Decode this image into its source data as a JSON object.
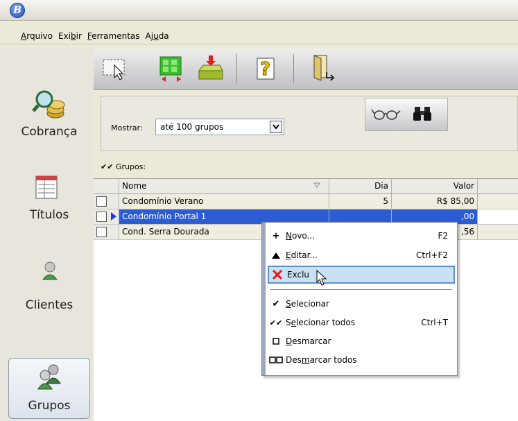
{
  "window": {
    "logo_letter": "B"
  },
  "menu": [
    "Arquivo",
    "Exibir",
    "Ferramentas",
    "Ajuda"
  ],
  "sidebar": {
    "items": [
      {
        "label": "Cobrança",
        "icon": "coins-magnifier-icon"
      },
      {
        "label": "Títulos",
        "icon": "documents-stack-icon"
      },
      {
        "label": "Clientes",
        "icon": "person-icon"
      },
      {
        "label": "Grupos",
        "icon": "group-people-icon",
        "active": true
      }
    ]
  },
  "toolbar": {
    "buttons": [
      "select-tool-icon",
      "group-transfer-icon",
      "import-icon",
      "help-icon",
      "exit-door-icon"
    ]
  },
  "filter": {
    "label": "Mostrar:",
    "value": "até 100 grupos",
    "buttons": [
      "glasses-icon",
      "binoculars-icon"
    ]
  },
  "grid": {
    "caption": "Grupos:",
    "columns": [
      "Nome",
      "Dia",
      "Valor"
    ],
    "rows": [
      {
        "name": "Condomínio Verano",
        "dia": "5",
        "valor": "R$ 85,00",
        "selected": false
      },
      {
        "name": "Condomínio Portal 1",
        "dia": "",
        "valor": ",00",
        "selected": true
      },
      {
        "name": "Cond. Serra Dourada",
        "dia": "",
        "valor": ",56",
        "selected": false
      }
    ]
  },
  "context_menu": {
    "items": [
      {
        "label": "Novo...",
        "shortcut": "F2",
        "icon": "plus-icon"
      },
      {
        "label": "Editar...",
        "shortcut": "Ctrl+F2",
        "icon": "triangle-up-icon"
      },
      {
        "label": "Excluir",
        "shortcut": "",
        "icon": "red-x-icon",
        "highlighted": true
      },
      {
        "label": "Selecionar",
        "shortcut": "",
        "icon": "check-icon"
      },
      {
        "label": "Selecionar todos",
        "shortcut": "Ctrl+T",
        "icon": "double-check-icon"
      },
      {
        "label": "Desmarcar",
        "shortcut": "",
        "icon": "box-icon"
      },
      {
        "label": "Desmarcar todos",
        "shortcut": "",
        "icon": "double-box-icon"
      }
    ],
    "excluir_visible": "Exclu"
  },
  "colors": {
    "selection": "#2b5cd3",
    "menu_highlight": "#c9e2f3",
    "row_bg": "#f0eee0"
  }
}
